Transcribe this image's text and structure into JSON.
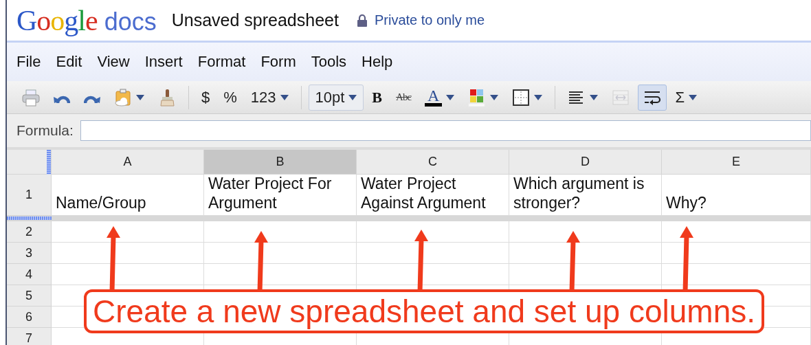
{
  "header": {
    "logo": {
      "google": "Google",
      "docs": "docs"
    },
    "title": "Unsaved spreadsheet",
    "privacy": "Private to only me"
  },
  "menu": [
    "File",
    "Edit",
    "View",
    "Insert",
    "Format",
    "Form",
    "Tools",
    "Help"
  ],
  "toolbar": [
    {
      "kind": "print",
      "dropdown": false,
      "pressed": false,
      "disabled": false
    },
    {
      "kind": "undo",
      "dropdown": false,
      "pressed": false,
      "disabled": false
    },
    {
      "kind": "redo",
      "dropdown": false,
      "pressed": false,
      "disabled": false
    },
    {
      "kind": "paste",
      "dropdown": true,
      "pressed": false,
      "disabled": false
    },
    {
      "kind": "brush",
      "dropdown": false,
      "pressed": false,
      "disabled": false
    },
    {
      "kind": "separator"
    },
    {
      "kind": "text",
      "label": "$",
      "dropdown": false,
      "pressed": false,
      "disabled": false
    },
    {
      "kind": "text",
      "label": "%",
      "dropdown": false,
      "pressed": false,
      "disabled": false
    },
    {
      "kind": "text",
      "label": "123",
      "dropdown": true,
      "pressed": false,
      "disabled": false
    },
    {
      "kind": "separator"
    },
    {
      "kind": "select",
      "label": "10pt",
      "dropdown": true,
      "pressed": false,
      "disabled": false
    },
    {
      "kind": "bold",
      "label": "B",
      "dropdown": false,
      "pressed": false,
      "disabled": false
    },
    {
      "kind": "strike",
      "label": "Abc",
      "dropdown": false,
      "pressed": false,
      "disabled": false
    },
    {
      "kind": "color",
      "label": "A",
      "dropdown": true,
      "pressed": false,
      "disabled": false
    },
    {
      "kind": "fill",
      "dropdown": true,
      "pressed": false,
      "disabled": false
    },
    {
      "kind": "borders",
      "dropdown": true,
      "pressed": false,
      "disabled": false
    },
    {
      "kind": "separator"
    },
    {
      "kind": "align",
      "dropdown": true,
      "pressed": false,
      "disabled": false
    },
    {
      "kind": "merge",
      "dropdown": false,
      "pressed": false,
      "disabled": true
    },
    {
      "kind": "wrap",
      "dropdown": false,
      "pressed": true,
      "disabled": false
    },
    {
      "kind": "text",
      "label": "Σ",
      "dropdown": true,
      "pressed": false,
      "disabled": false
    }
  ],
  "formula": {
    "label": "Formula:"
  },
  "grid": {
    "columns": [
      {
        "label": "A",
        "selected": false
      },
      {
        "label": "B",
        "selected": true
      },
      {
        "label": "C",
        "selected": false
      },
      {
        "label": "D",
        "selected": false
      },
      {
        "label": "E",
        "selected": false
      }
    ],
    "rows": [
      {
        "number": "1",
        "cells": [
          "Name/Group",
          "Water Project For Argument",
          "Water Project Against Argument",
          "Which argument is stronger?",
          "Why?"
        ]
      },
      {
        "number": "2"
      },
      {
        "number": "3"
      },
      {
        "number": "4"
      },
      {
        "number": "5"
      },
      {
        "number": "6"
      },
      {
        "number": "7"
      }
    ]
  },
  "callout": {
    "text": "Create a new spreadsheet and set up columns."
  }
}
